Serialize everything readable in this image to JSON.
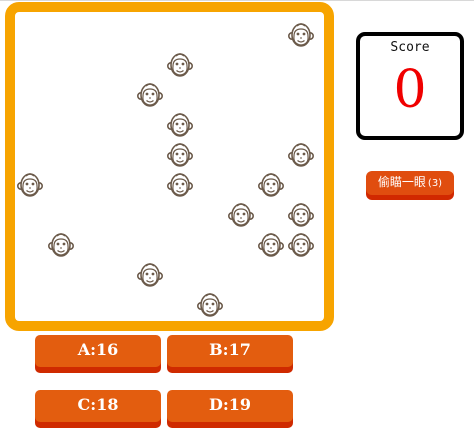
{
  "score": {
    "label": "Score",
    "value": "0"
  },
  "peek_button": {
    "label": "偷瞄一眼",
    "count": "(3)"
  },
  "answers": [
    {
      "label": "A:16"
    },
    {
      "label": "B:17"
    },
    {
      "label": "C:18"
    },
    {
      "label": "D:19"
    }
  ],
  "colors": {
    "board_border": "#f7a400",
    "button_face": "#e35d0f",
    "button_shadow": "#cf2a00",
    "score_value": "#f00000",
    "monkey_outline": "#6b5a4a"
  },
  "monkey_icon": "monkey-face-icon"
}
